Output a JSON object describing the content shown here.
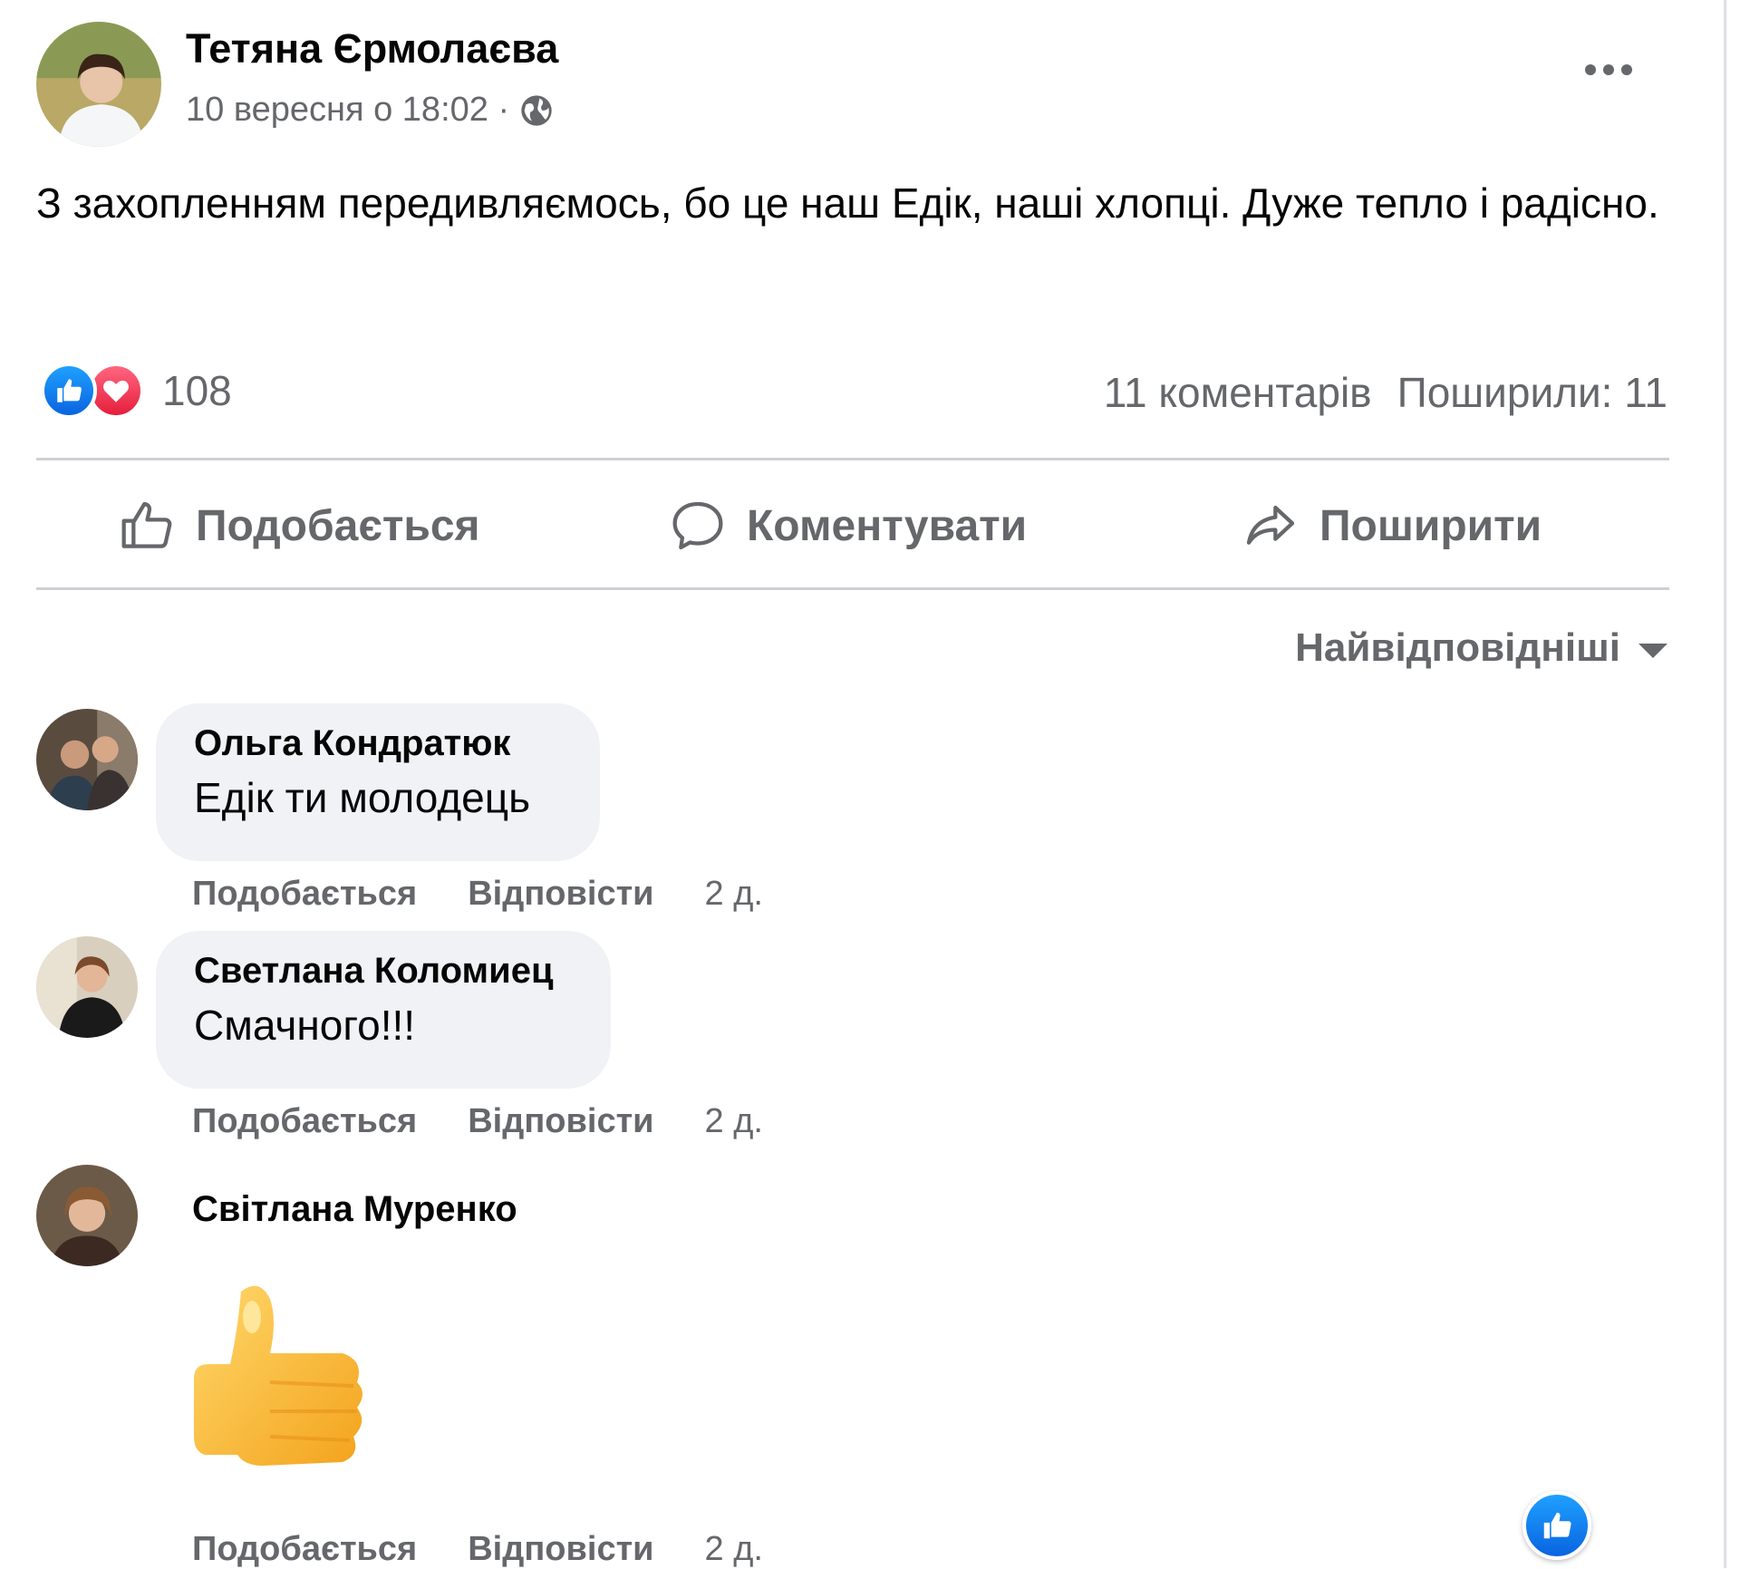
{
  "post": {
    "author": "Тетяна Єрмолаєва",
    "timestamp": "10 вересня о 18:02 ·",
    "privacy_icon": "globe-icon",
    "text": "З захопленням передивляємось, бо це наш Едік, наші хлопці. Дуже тепло і радісно.",
    "reaction_count": "108",
    "reaction_icons": [
      "like-icon",
      "love-icon"
    ],
    "comments_count": "11 коментарів",
    "shares": "Поширили: 11"
  },
  "actions": {
    "like": "Подобається",
    "comment": "Коментувати",
    "share": "Поширити"
  },
  "sort_label": "Найвідповідніші",
  "comments": [
    {
      "name": "Ольга Кондратюк",
      "text": "Едік ти молодець",
      "like": "Подобається",
      "reply": "Відповісти",
      "time": "2 д."
    },
    {
      "name": "Светлана Коломиец",
      "text": "Смачного!!!",
      "like": "Подобається",
      "reply": "Відповісти",
      "time": "2 д."
    },
    {
      "name": "Світлана Муренко",
      "sticker": "thumbs-up-sticker",
      "like": "Подобається",
      "reply": "Відповісти",
      "time": "2 д."
    }
  ],
  "colors": {
    "secondary_text": "#65676b",
    "bubble_bg": "#f0f2f5",
    "like_blue": "#1877f2",
    "love_red": "#f33e58"
  }
}
